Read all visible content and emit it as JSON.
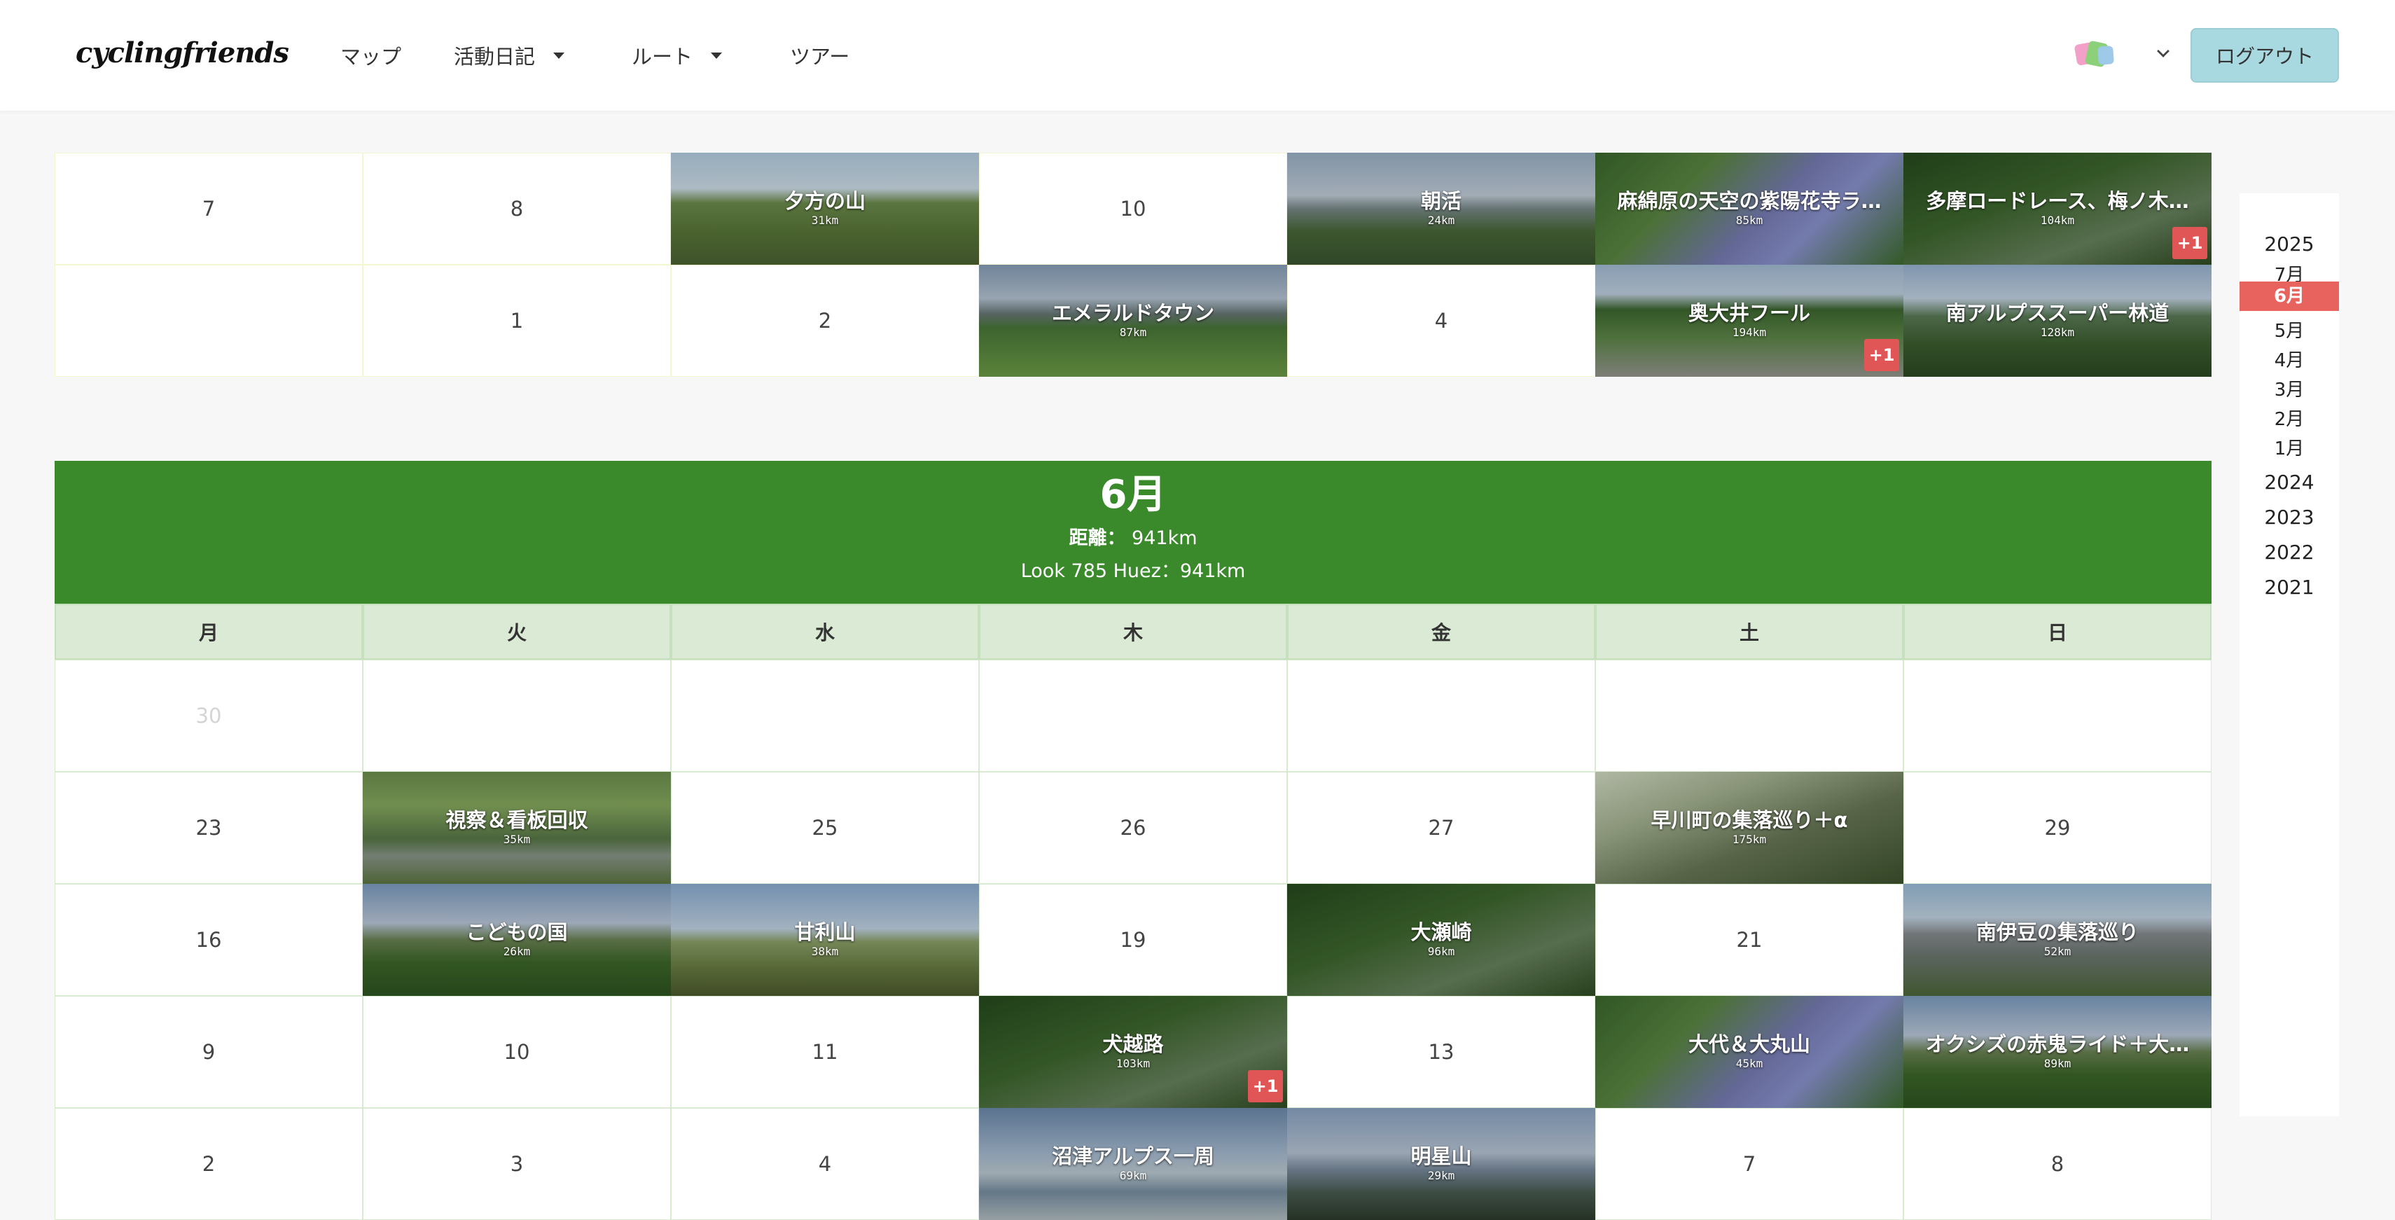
{
  "app": {
    "logo": "cyclingfriends"
  },
  "nav": [
    {
      "label": "マップ",
      "has_dropdown": false
    },
    {
      "label": "活動日記",
      "has_dropdown": true
    },
    {
      "label": "ルート",
      "has_dropdown": true
    },
    {
      "label": "ツアー",
      "has_dropdown": false
    }
  ],
  "header": {
    "logout_label": "ログアウト",
    "avatar_icon": "user-avatar-icon"
  },
  "prev_month": {
    "rows": [
      [
        {
          "day": "7"
        },
        {
          "day": "8"
        },
        {
          "ride": "夕方の山",
          "dist": "31km",
          "photo": "p-mtn"
        },
        {
          "day": "10"
        },
        {
          "ride": "朝活",
          "dist": "24km",
          "photo": "p-fuji"
        },
        {
          "ride": "麻綿原の天空の紫陽花寺ラ…",
          "dist": "85km",
          "photo": "p-hydr"
        },
        {
          "ride": "多摩ロードレース、梅ノ木…",
          "dist": "104km",
          "photo": "p-forest",
          "extra": "+1"
        }
      ],
      [
        {
          "day": ""
        },
        {
          "day": "1"
        },
        {
          "day": "2"
        },
        {
          "ride": "エメラルドタウン",
          "dist": "87km",
          "photo": "p-field"
        },
        {
          "day": "4"
        },
        {
          "ride": "奥大井フール",
          "dist": "194km",
          "photo": "p-road",
          "extra": "+1"
        },
        {
          "ride": "南アルプススーパー林道",
          "dist": "128km",
          "photo": "p-valley"
        }
      ]
    ]
  },
  "month": {
    "title": "6月",
    "distance_label": "距離：",
    "distance": "941km",
    "bike_summary": "Look 785 Huez：941km"
  },
  "weekdays": [
    "月",
    "火",
    "水",
    "木",
    "金",
    "土",
    "日"
  ],
  "weeks": [
    [
      {
        "day": "30",
        "faded": true
      },
      {
        "day": ""
      },
      {
        "day": ""
      },
      {
        "day": ""
      },
      {
        "day": ""
      },
      {
        "day": ""
      },
      {
        "day": ""
      }
    ],
    [
      {
        "day": "23"
      },
      {
        "ride": "視察＆看板回収",
        "dist": "35km",
        "photo": "p-wet"
      },
      {
        "day": "25"
      },
      {
        "day": "26"
      },
      {
        "day": "27"
      },
      {
        "ride": "早川町の集落巡り＋α",
        "dist": "175km",
        "photo": "p-village"
      },
      {
        "day": "29"
      }
    ],
    [
      {
        "day": "16"
      },
      {
        "ride": "こどもの国",
        "dist": "26km",
        "photo": "p-tea"
      },
      {
        "ride": "甘利山",
        "dist": "38km",
        "photo": "p-ridge"
      },
      {
        "day": "19"
      },
      {
        "ride": "大瀬崎",
        "dist": "96km",
        "photo": "p-forest"
      },
      {
        "day": "21"
      },
      {
        "ride": "南伊豆の集落巡り",
        "dist": "52km",
        "photo": "p-town"
      }
    ],
    [
      {
        "day": "9"
      },
      {
        "day": "10"
      },
      {
        "day": "11"
      },
      {
        "ride": "犬越路",
        "dist": "103km",
        "photo": "p-forest",
        "extra": "+1"
      },
      {
        "day": "13"
      },
      {
        "ride": "大代＆大丸山",
        "dist": "45km",
        "photo": "p-hydr"
      },
      {
        "ride": "オクシズの赤鬼ライド＋大…",
        "dist": "89km",
        "photo": "p-tea"
      }
    ],
    [
      {
        "day": "2"
      },
      {
        "day": "3"
      },
      {
        "day": "4"
      },
      {
        "ride": "沼津アルプス一周",
        "dist": "69km",
        "photo": "p-paddy"
      },
      {
        "ride": "明星山",
        "dist": "29km",
        "photo": "p-view"
      },
      {
        "day": "7"
      },
      {
        "day": "8"
      }
    ]
  ],
  "side_nav": [
    {
      "label": "2025",
      "type": "year"
    },
    {
      "label": "7月",
      "type": "month"
    },
    {
      "label": "6月",
      "type": "month",
      "active": true
    },
    {
      "label": "5月",
      "type": "month"
    },
    {
      "label": "4月",
      "type": "month"
    },
    {
      "label": "3月",
      "type": "month"
    },
    {
      "label": "2月",
      "type": "month"
    },
    {
      "label": "1月",
      "type": "month"
    },
    {
      "label": "2024",
      "type": "year"
    },
    {
      "label": "2023",
      "type": "year"
    },
    {
      "label": "2022",
      "type": "year"
    },
    {
      "label": "2021",
      "type": "year"
    }
  ],
  "colors": {
    "month_header": "#3a8a2b",
    "weekday_bg": "#dbead5",
    "active_month": "#e8625e",
    "extra_badge": "#e05555",
    "logout_bg": "#a9d9e0"
  }
}
